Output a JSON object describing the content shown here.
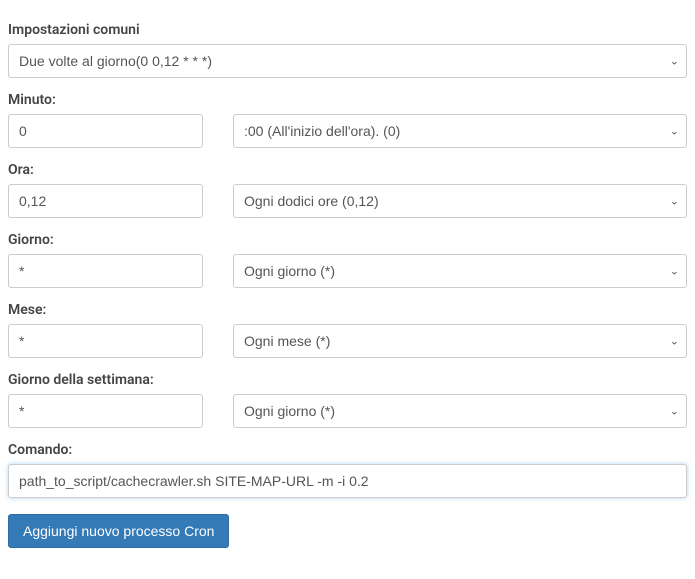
{
  "common": {
    "label": "Impostazioni comuni",
    "selected": "Due volte al giorno(0 0,12 * * *)"
  },
  "minute": {
    "label": "Minuto:",
    "value": "0",
    "select": ":00 (All'inizio dell'ora). (0)"
  },
  "hour": {
    "label": "Ora:",
    "value": "0,12",
    "select": "Ogni dodici ore (0,12)"
  },
  "day": {
    "label": "Giorno:",
    "value": "*",
    "select": "Ogni giorno (*)"
  },
  "month": {
    "label": "Mese:",
    "value": "*",
    "select": "Ogni mese (*)"
  },
  "weekday": {
    "label": "Giorno della settimana:",
    "value": "*",
    "select": "Ogni giorno (*)"
  },
  "command": {
    "label": "Comando:",
    "value": "path_to_script/cachecrawler.sh SITE-MAP-URL -m -i 0.2"
  },
  "submit": {
    "label": "Aggiungi nuovo processo Cron"
  }
}
